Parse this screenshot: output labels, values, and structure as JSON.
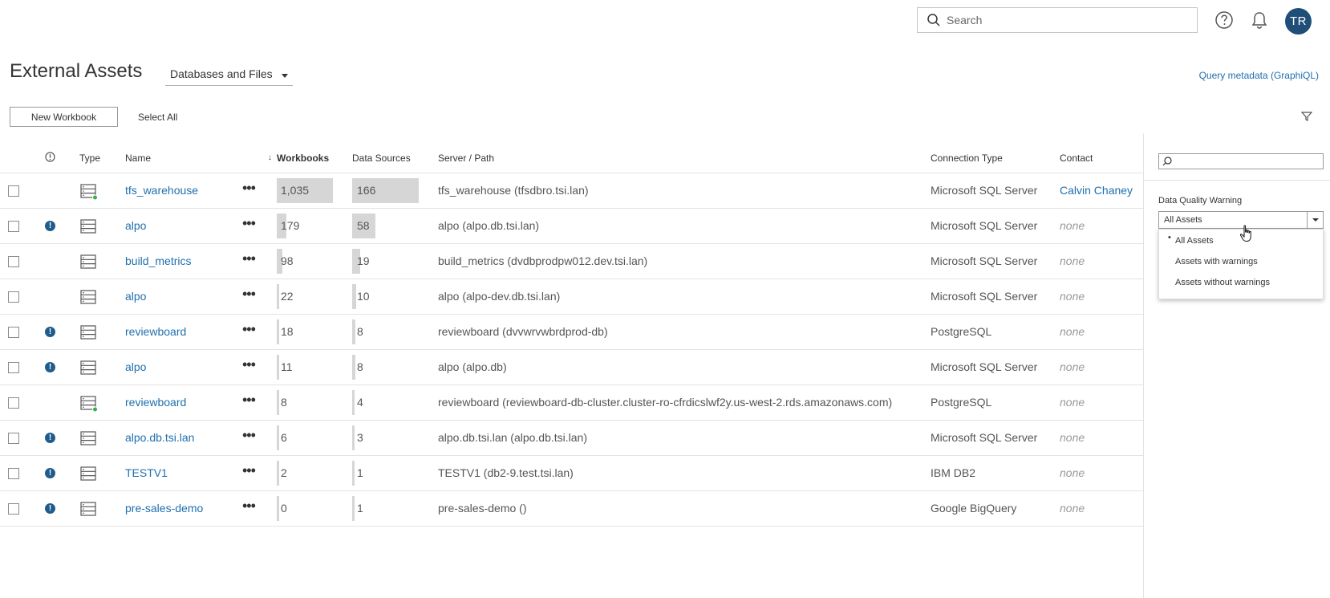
{
  "search": {
    "placeholder": "Search"
  },
  "user": {
    "initials": "TR"
  },
  "header": {
    "title": "External Assets",
    "asset_type": "Databases and Files",
    "query_link": "Query metadata (GraphiQL)"
  },
  "actions": {
    "new_workbook": "New Workbook",
    "select_all": "Select All"
  },
  "columns": {
    "type": "Type",
    "name": "Name",
    "workbooks": "Workbooks",
    "data_sources": "Data Sources",
    "server_path": "Server / Path",
    "connection_type": "Connection Type",
    "contact": "Contact"
  },
  "rows": [
    {
      "name": "tfs_warehouse",
      "warning": false,
      "status_dot": true,
      "workbooks": "1,035",
      "workbooks_value": 1035,
      "data_sources": "166",
      "data_sources_value": 166,
      "path": "tfs_warehouse (tfsdbro.tsi.lan)",
      "connection": "Microsoft SQL Server",
      "contact": "Calvin Chaney"
    },
    {
      "name": "alpo",
      "warning": true,
      "status_dot": false,
      "workbooks": "179",
      "workbooks_value": 179,
      "data_sources": "58",
      "data_sources_value": 58,
      "path": "alpo (alpo.db.tsi.lan)",
      "connection": "Microsoft SQL Server",
      "contact": "none"
    },
    {
      "name": "build_metrics",
      "warning": false,
      "status_dot": false,
      "workbooks": "98",
      "workbooks_value": 98,
      "data_sources": "19",
      "data_sources_value": 19,
      "path": "build_metrics (dvdbprodpw012.dev.tsi.lan)",
      "connection": "Microsoft SQL Server",
      "contact": "none"
    },
    {
      "name": "alpo",
      "warning": false,
      "status_dot": false,
      "workbooks": "22",
      "workbooks_value": 22,
      "data_sources": "10",
      "data_sources_value": 10,
      "path": "alpo (alpo-dev.db.tsi.lan)",
      "connection": "Microsoft SQL Server",
      "contact": "none"
    },
    {
      "name": "reviewboard",
      "warning": true,
      "status_dot": false,
      "workbooks": "18",
      "workbooks_value": 18,
      "data_sources": "8",
      "data_sources_value": 8,
      "path": "reviewboard (dvvwrvwbrdprod-db)",
      "connection": "PostgreSQL",
      "contact": "none"
    },
    {
      "name": "alpo",
      "warning": true,
      "status_dot": false,
      "workbooks": "11",
      "workbooks_value": 11,
      "data_sources": "8",
      "data_sources_value": 8,
      "path": "alpo (alpo.db)",
      "connection": "Microsoft SQL Server",
      "contact": "none"
    },
    {
      "name": "reviewboard",
      "warning": false,
      "status_dot": true,
      "workbooks": "8",
      "workbooks_value": 8,
      "data_sources": "4",
      "data_sources_value": 4,
      "path": "reviewboard (reviewboard-db-cluster.cluster-ro-cfrdicslwf2y.us-west-2.rds.amazonaws.com)",
      "connection": "PostgreSQL",
      "contact": "none"
    },
    {
      "name": "alpo.db.tsi.lan",
      "warning": true,
      "status_dot": false,
      "workbooks": "6",
      "workbooks_value": 6,
      "data_sources": "3",
      "data_sources_value": 3,
      "path": "alpo.db.tsi.lan (alpo.db.tsi.lan)",
      "connection": "Microsoft SQL Server",
      "contact": "none"
    },
    {
      "name": "TESTV1",
      "warning": true,
      "status_dot": false,
      "workbooks": "2",
      "workbooks_value": 2,
      "data_sources": "1",
      "data_sources_value": 1,
      "path": "TESTV1 (db2-9.test.tsi.lan)",
      "connection": "IBM DB2",
      "contact": "none"
    },
    {
      "name": "pre-sales-demo",
      "warning": true,
      "status_dot": false,
      "workbooks": "0",
      "workbooks_value": 0,
      "data_sources": "1",
      "data_sources_value": 1,
      "path": "pre-sales-demo ()",
      "connection": "Google BigQuery",
      "contact": "none"
    }
  ],
  "filter_panel": {
    "label": "Data Quality Warning",
    "selected": "All Assets",
    "options": [
      "All Assets",
      "Assets with warnings",
      "Assets without warnings"
    ]
  },
  "colors": {
    "link": "#1f6fae",
    "avatar": "#1f4e79",
    "warning": "#1f5c8b",
    "bar": "#d6d6d6",
    "status_dot": "#3fae49"
  },
  "icons": [
    "search-icon",
    "help-icon",
    "bell-icon",
    "filter-icon",
    "warning-icon",
    "database-icon",
    "more-icon",
    "hand-cursor-icon"
  ]
}
